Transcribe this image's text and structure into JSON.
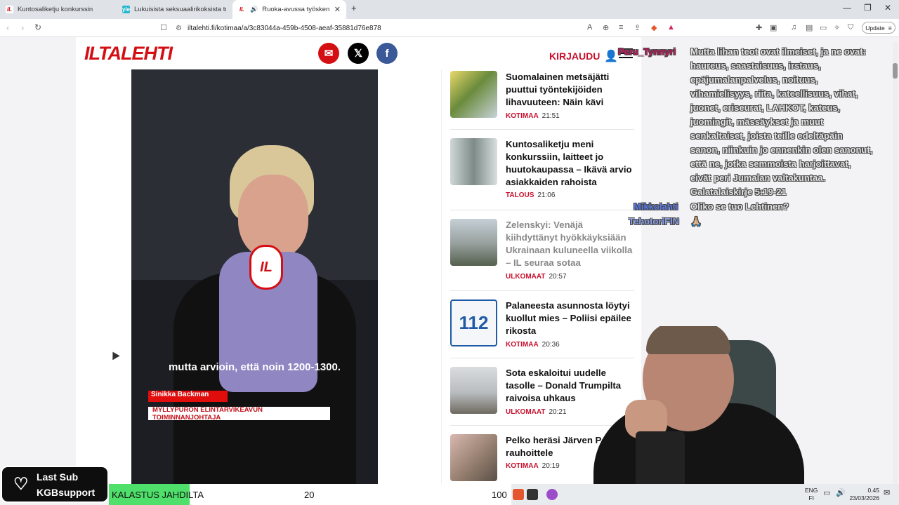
{
  "browser": {
    "tabs": [
      {
        "label": "Kuntosaliketju konkurssin",
        "favicon": "IL"
      },
      {
        "label": "Lukuisista seksuaalirikoksista tuomittu",
        "favicon": "yle"
      },
      {
        "label": "Ruoka-avussa työskennellyt A",
        "favicon": "IL"
      }
    ],
    "url": "iltalehti.fi/kotimaa/a/3c83044a-459b-4508-aeaf-35881d76e878",
    "update_label": "Update"
  },
  "site": {
    "logo": "ILTALEHTI",
    "login": "KIRJAUDU",
    "social": [
      "mail",
      "x",
      "facebook"
    ]
  },
  "video": {
    "mic_logo": "IL",
    "subtitle": "mutta arvioin, että noin 1200-1300.",
    "name_plate": "Sinikka Backman",
    "role_plate": "MYLLYPURON ELINTARVIKEAVUN TOIMINNANJOHTAJA"
  },
  "articles": [
    {
      "title": "Suomalainen metsäjätti puuttui työntekijöiden lihavuuteen: Näin kävi",
      "category": "KOTIMAA",
      "time": "21:51",
      "dim": false
    },
    {
      "title": "Kuntosaliketju meni konkurssiin, laitteet jo huutokaupassa – Ikävä arvio asiakkaiden rahoista",
      "category": "TALOUS",
      "time": "21:06",
      "dim": false
    },
    {
      "title": "Zelenskyi: Venäjä kiihdyttänyt hyökkäyksiään Ukrainaan kuluneella viikolla – IL seuraa sotaa",
      "category": "ULKOMAAT",
      "time": "20:57",
      "dim": true
    },
    {
      "title": "Palaneesta asunnosta löytyi kuollut mies – Poliisi epäilee rikosta",
      "category": "KOTIMAA",
      "time": "20:36",
      "dim": false
    },
    {
      "title": "Sota eskaloitui uudelle tasolle – Donald Trumpilta raivoisa uhkaus",
      "category": "ULKOMAAT",
      "time": "20:21",
      "dim": false
    },
    {
      "title": "Pelko heräsi Järven Poliisi rauhoittele",
      "category": "KOTIMAA",
      "time": "20:19",
      "dim": false
    }
  ],
  "chat": {
    "user1": "Peru_Tynnyri",
    "lines1": [
      "Mutta lihan teot ovat ilmeiset, ja ne ovat:",
      "haureus, saastaisuus, irstaus,",
      "epäjumalanpalvelus, noituus,",
      "vihamielisyys, riita, kateellisuus, vihat,",
      "juonet, eriseurat, LAHKOT, kateus,",
      "juomingit, mässäykset ja muut",
      "senkaltaiset, joista teille edeltäpäin",
      "sanon, niinkuin jo ennenkin olen sanonut,",
      "että ne, jotka semmoista harjoittavat,",
      "eivät peri Jumalan valtakuntaa.",
      "Galatalaiskirje 5:19-21"
    ],
    "user2": "Mikkolahti",
    "line2": "Oliko se tuo Lehtinen?",
    "user3": "TehotoriFIN",
    "line3": "🙏🏼"
  },
  "overlay": {
    "last_sub_title": "Last Sub",
    "last_sub_name": "KGBsupport",
    "goal_label": "KALASTUS JAHDILTA",
    "goal_current": "20",
    "goal_max": "100",
    "goal_progress": 0.2
  },
  "taskbar": {
    "lang_top": "ENG",
    "lang_bottom": "FI",
    "clock_time": "0.45",
    "clock_date": "23/03/2026"
  }
}
